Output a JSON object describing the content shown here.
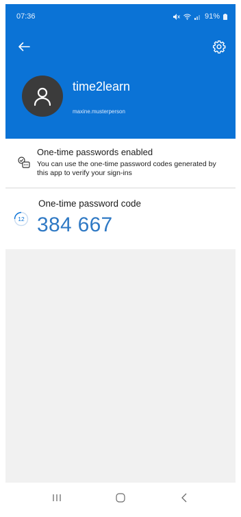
{
  "status_bar": {
    "time": "07:36",
    "battery": "91%"
  },
  "header": {
    "back_icon": "arrow-left-icon",
    "settings_icon": "gear-icon",
    "account_name": "time2learn",
    "username": "maxine.musterperson",
    "colors": {
      "background": "#0b73d6",
      "avatar": "#3b3b3b"
    }
  },
  "info": {
    "icon": "passcode-check-icon",
    "title": "One-time passwords enabled",
    "description": "You can use the one-time password codes generated by this app to verify your sign-ins"
  },
  "otp": {
    "label": "One-time password code",
    "code": "384 667",
    "seconds_remaining": "12",
    "code_color": "#2f79c4"
  },
  "nav": {
    "recent_icon": "recent-apps-icon",
    "home_icon": "home-icon",
    "back_icon": "nav-back-icon"
  }
}
